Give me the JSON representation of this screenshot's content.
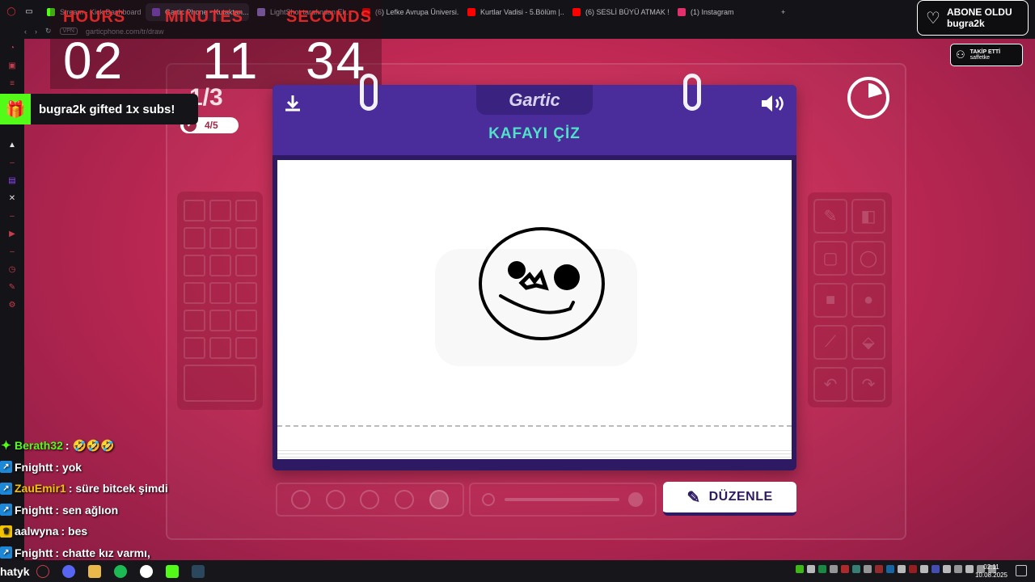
{
  "browser": {
    "tabs": [
      {
        "label": "Stream - Kick Dashboard",
        "active": false,
        "color": "#53fc18"
      },
      {
        "label": "Gartic Phone - Kutaktan...",
        "active": true,
        "color": "#8a4fd8"
      },
      {
        "label": "LightShot tarafından Ek...",
        "active": false,
        "color": "#9a7ad8"
      },
      {
        "label": "(6) Lefke Avrupa Üniversi...",
        "active": false,
        "color": "#ff0000"
      },
      {
        "label": "Kurtlar Vadisi - 5.Bölüm |...",
        "active": false,
        "color": "#ff0000"
      },
      {
        "label": "(6) SESLİ BÜYÜ ATMAK !...",
        "active": false,
        "color": "#ff0000"
      },
      {
        "label": "(1) Instagram",
        "active": false,
        "color": "#e1306c"
      }
    ],
    "new_tab": "+",
    "vpn": "VPN",
    "url": "garticphone.com/tr/draw"
  },
  "timer": {
    "labels": [
      "HOURS",
      "MINUTES",
      "SECONDS"
    ],
    "hours": "02",
    "minutes": "11",
    "seconds": "34"
  },
  "game": {
    "round": "1/3",
    "progress": "4/5",
    "brand": "Gartic",
    "title": "KAFAYI ÇİZ",
    "edit_button": "DÜZENLE"
  },
  "alerts": {
    "gift": "bugra2k gifted 1x subs!",
    "sub_title": "ABONE OLDU",
    "sub_user": "bugra2k",
    "follow_title": "TAKİP ETTİ",
    "follow_user": "saffetke"
  },
  "chat": [
    {
      "user": "Berath32",
      "msg": ": 🤣🤣🤣",
      "badge": "g",
      "color": "#53fc18"
    },
    {
      "user": "Fnightt",
      "msg": ": yok",
      "badge": "b",
      "color": "#ffffff"
    },
    {
      "user": "ZauEmir1",
      "msg": ": süre bitcek şimdi",
      "badge": "b",
      "color": "#f5c400"
    },
    {
      "user": "Fnightt",
      "msg": ": sen ağlıon",
      "badge": "b",
      "color": "#ffffff"
    },
    {
      "user": "aalwyna",
      "msg": ": bes",
      "badge": "c",
      "color": "#ffffff"
    },
    {
      "user": "Fnightt",
      "msg": ": chatte kız varmı,",
      "badge": "b",
      "color": "#ffffff"
    }
  ],
  "taskbar": {
    "left_text": "hatyk",
    "time": "02:11",
    "date": "10.08.2025"
  }
}
